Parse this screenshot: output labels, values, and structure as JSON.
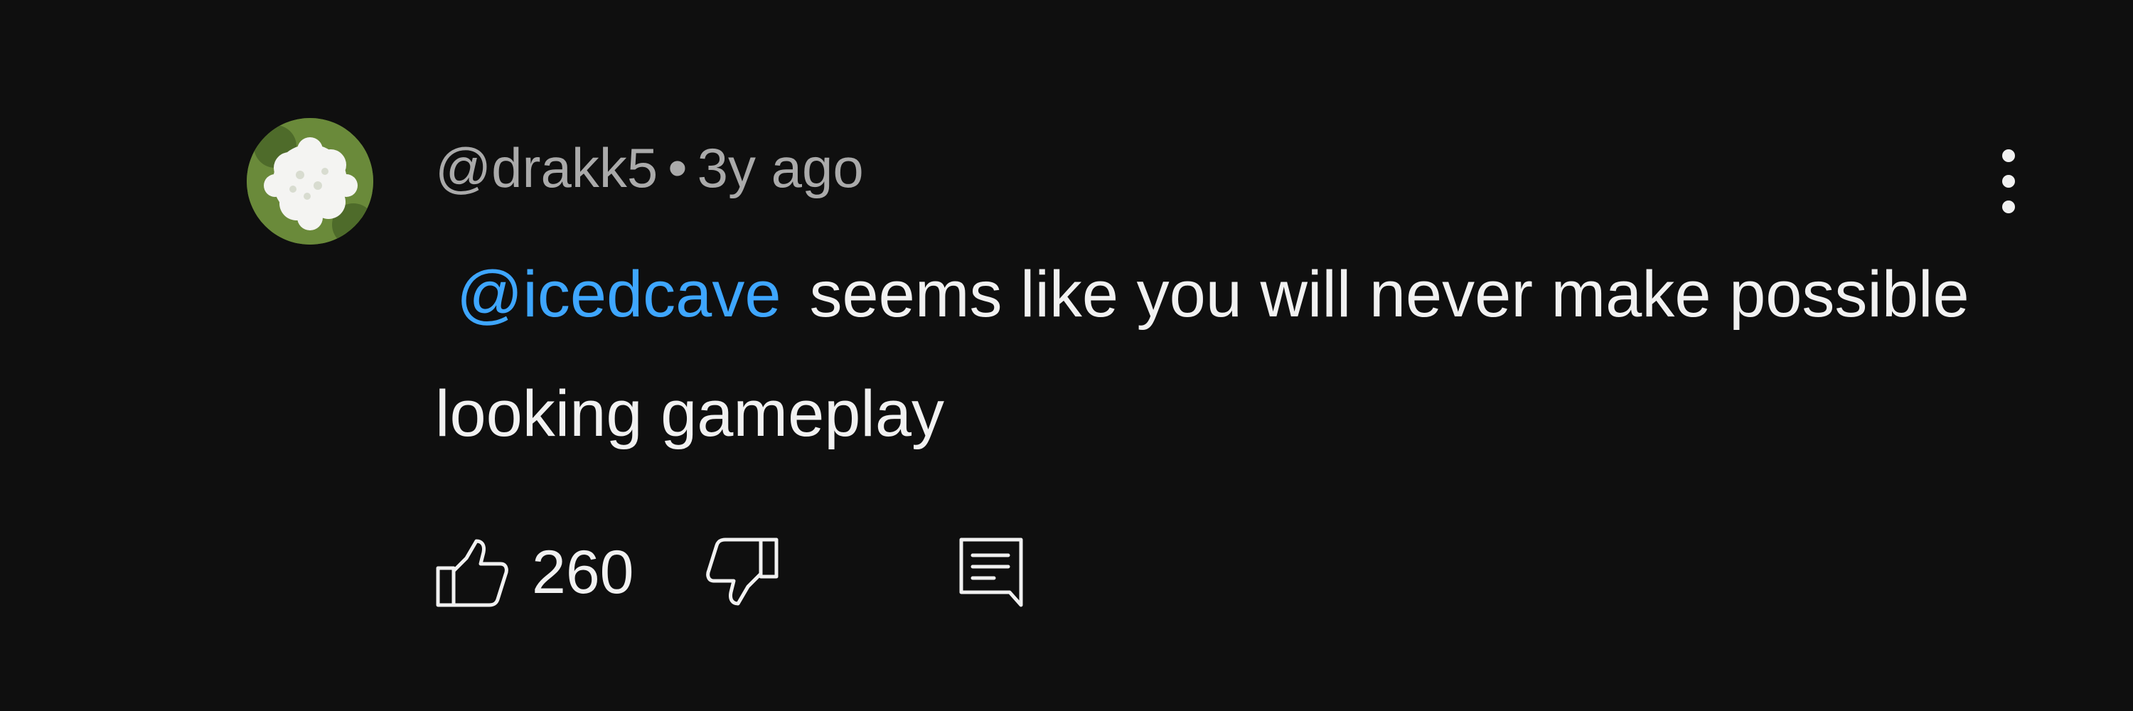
{
  "comment": {
    "author": "@drakk5",
    "separator": "•",
    "time_ago": "3y ago",
    "mention": "@icedcave",
    "text": "seems like you will never make possible looking gameplay",
    "like_count": "260"
  },
  "colors": {
    "background": "#0f0f0f",
    "text_primary": "#f1f1f1",
    "text_secondary": "#aaaaaa",
    "mention": "#3ea6ff"
  },
  "icons": {
    "menu": "more-vertical-icon",
    "like": "thumbs-up-icon",
    "dislike": "thumbs-down-icon",
    "reply": "reply-comment-icon"
  }
}
